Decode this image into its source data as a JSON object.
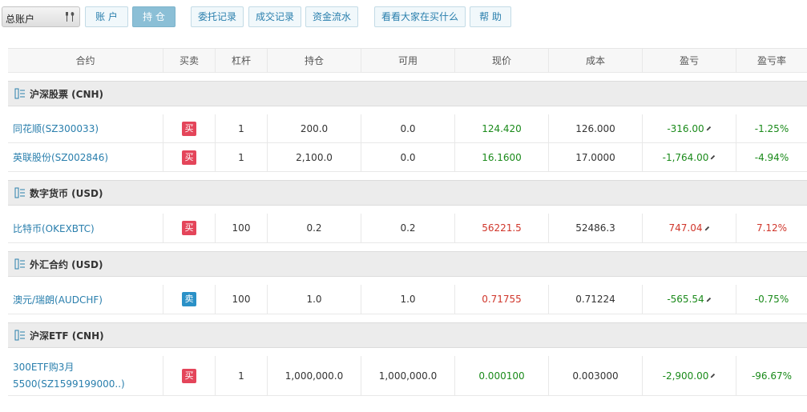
{
  "toolbar": {
    "account_select": "总账户",
    "buttons": [
      {
        "label": "账 户"
      },
      {
        "label": "持 仓"
      },
      {
        "label": "委托记录"
      },
      {
        "label": "成交记录"
      },
      {
        "label": "资金流水"
      },
      {
        "label": "看看大家在买什么"
      },
      {
        "label": "帮 助"
      }
    ]
  },
  "colors": {
    "accent": "#2a7fad",
    "buy": "#e4455a",
    "sell": "#2b91c7",
    "gain": "#1a8a1a",
    "loss": "#d0362b"
  },
  "columns": [
    "合约",
    "买卖",
    "杠杆",
    "持仓",
    "可用",
    "现价",
    "成本",
    "盈亏",
    "盈亏率"
  ],
  "groups": [
    {
      "title": "沪深股票 (CNH)",
      "rows": [
        {
          "name": "同花顺(SZ300033)",
          "side": "买",
          "leverage": "1",
          "position": "200.0",
          "available": "0.0",
          "price": "124.420",
          "cost": "126.000",
          "pnl": "-316.00",
          "pnl_rate": "-1.25%"
        },
        {
          "name": "英联股份(SZ002846)",
          "side": "买",
          "leverage": "1",
          "position": "2,100.0",
          "available": "0.0",
          "price": "16.1600",
          "cost": "17.0000",
          "pnl": "-1,764.00",
          "pnl_rate": "-4.94%"
        }
      ]
    },
    {
      "title": "数字货币 (USD)",
      "rows": [
        {
          "name": "比特币(OKEXBTC)",
          "side": "买",
          "leverage": "100",
          "position": "0.2",
          "available": "0.2",
          "price": "56221.5",
          "cost": "52486.3",
          "pnl": "747.04",
          "pnl_rate": "7.12%"
        }
      ]
    },
    {
      "title": "外汇合约 (USD)",
      "rows": [
        {
          "name": "澳元/瑞朗(AUDCHF)",
          "side": "卖",
          "leverage": "100",
          "position": "1.0",
          "available": "1.0",
          "price": "0.71755",
          "cost": "0.71224",
          "pnl": "-565.54",
          "pnl_rate": "-0.75%"
        }
      ]
    },
    {
      "title": "沪深ETF (CNH)",
      "rows": [
        {
          "name_line1": "300ETF购3月",
          "name_line2": "5500(SZ1599199000..)",
          "side": "买",
          "leverage": "1",
          "position": "1,000,000.0",
          "available": "1,000,000.0",
          "price": "0.000100",
          "cost": "0.003000",
          "pnl": "-2,900.00",
          "pnl_rate": "-96.67%"
        }
      ]
    }
  ]
}
